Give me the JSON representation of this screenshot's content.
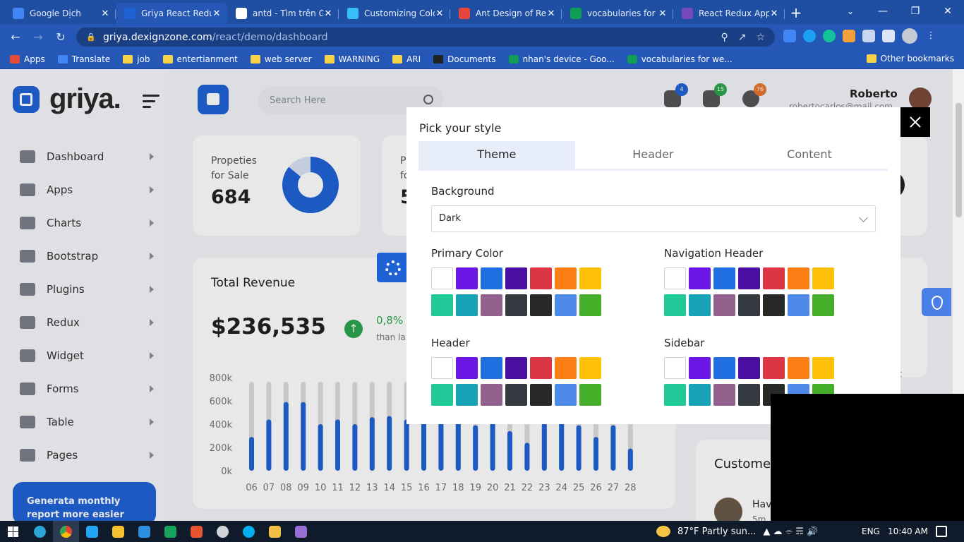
{
  "browser": {
    "tabs": [
      {
        "title": "Google Dịch",
        "color": "#4285f4",
        "active": false
      },
      {
        "title": "Griya React Redu",
        "color": "#1f62d6",
        "active": true
      },
      {
        "title": "antd - Tìm trên G",
        "color": "#ffffff",
        "active": false
      },
      {
        "title": "Customizing Colo",
        "color": "#38bdf8",
        "active": false
      },
      {
        "title": "Ant Design of Re",
        "color": "#e8453c",
        "active": false
      },
      {
        "title": "vocabularies for v",
        "color": "#0f9d58",
        "active": false
      },
      {
        "title": "React Redux App",
        "color": "#764abc",
        "active": false
      }
    ],
    "url_host": "griya.dexignzone.com",
    "url_path": "/react/demo/dashboard",
    "bookmarks": [
      {
        "label": "Apps",
        "type": "apps"
      },
      {
        "label": "Translate",
        "type": "translate"
      },
      {
        "label": "job",
        "type": "folder"
      },
      {
        "label": "entertianment",
        "type": "folder"
      },
      {
        "label": "web server",
        "type": "folder"
      },
      {
        "label": "WARNING",
        "type": "folder"
      },
      {
        "label": "ARI",
        "type": "folder"
      },
      {
        "label": "Documents",
        "type": "doc"
      },
      {
        "label": "nhan's device - Goo...",
        "type": "sheet"
      },
      {
        "label": "vocabularies for we...",
        "type": "sheet"
      }
    ],
    "other_bookmarks": "Other bookmarks"
  },
  "app": {
    "logo_text": "griya.",
    "search_placeholder": "Search Here",
    "notifications": [
      {
        "icon": "bell-icon",
        "count": "4",
        "color": "#1f62d6"
      },
      {
        "icon": "mail-icon",
        "count": "15",
        "color": "#2ea44f"
      },
      {
        "icon": "chat-icon",
        "count": "76",
        "color": "#e8752e"
      }
    ],
    "user_name": "Roberto",
    "user_email": "robertocarlos@mail.com",
    "menu": [
      {
        "label": "Dashboard",
        "icon": "dashboard-icon"
      },
      {
        "label": "Apps",
        "icon": "info-icon"
      },
      {
        "label": "Charts",
        "icon": "chart-icon"
      },
      {
        "label": "Bootstrap",
        "icon": "star-icon"
      },
      {
        "label": "Plugins",
        "icon": "heart-icon"
      },
      {
        "label": "Redux",
        "icon": "redux-icon"
      },
      {
        "label": "Widget",
        "icon": "widget-icon"
      },
      {
        "label": "Forms",
        "icon": "printer-icon"
      },
      {
        "label": "Table",
        "icon": "table-icon"
      },
      {
        "label": "Pages",
        "icon": "pages-icon"
      }
    ],
    "promo_text": "Generata monthly report more easier",
    "card1": {
      "label": "Propeties for Sale",
      "value": "684"
    },
    "card2": {
      "label_partial": "P",
      "label_partial2": "fo",
      "value_partial": "5"
    },
    "revenue": {
      "title": "Total Revenue",
      "value": "$236,535",
      "change": "0,8%",
      "compare": "than la"
    },
    "right_texts": [
      "ys",
      "nit",
      "ent"
    ],
    "customers": {
      "title": "Custome",
      "first_name": "Hav",
      "first_meta": "5m"
    }
  },
  "chart_data": {
    "type": "bar",
    "categories": [
      "06",
      "07",
      "08",
      "09",
      "10",
      "11",
      "12",
      "13",
      "14",
      "15",
      "16",
      "17",
      "18",
      "19",
      "20",
      "21",
      "22",
      "23",
      "24",
      "25",
      "26",
      "27",
      "28"
    ],
    "values": [
      290,
      440,
      590,
      590,
      400,
      440,
      400,
      460,
      470,
      440,
      540,
      510,
      450,
      390,
      430,
      340,
      240,
      410,
      490,
      390,
      290,
      390,
      190
    ],
    "ylim": [
      0,
      800
    ],
    "yticks": [
      "800k",
      "600k",
      "400k",
      "200k",
      "0k"
    ],
    "colors": {
      "bar": "#1f62d6",
      "track": "#dcdcdc"
    }
  },
  "modal": {
    "title": "Pick your style",
    "tabs": [
      "Theme",
      "Header",
      "Content"
    ],
    "active_tab": "Theme",
    "background_label": "Background",
    "background_value": "Dark",
    "sections": {
      "primary": "Primary Color",
      "navheader": "Navigation Header",
      "header": "Header",
      "sidebar": "Sidebar"
    },
    "palette": [
      "#ffffff",
      "#6c16e6",
      "#1f6fe0",
      "#4b0ea3",
      "#dc3545",
      "#fd7e14",
      "#ffc107",
      "#20c997",
      "#17a2b8",
      "#94618e",
      "#343a40",
      "#282828",
      "#4d8aea",
      "#44b02a"
    ]
  },
  "taskbar": {
    "weather": "87°F  Partly sun...",
    "lang": "ENG",
    "time": "10:40 AM"
  }
}
